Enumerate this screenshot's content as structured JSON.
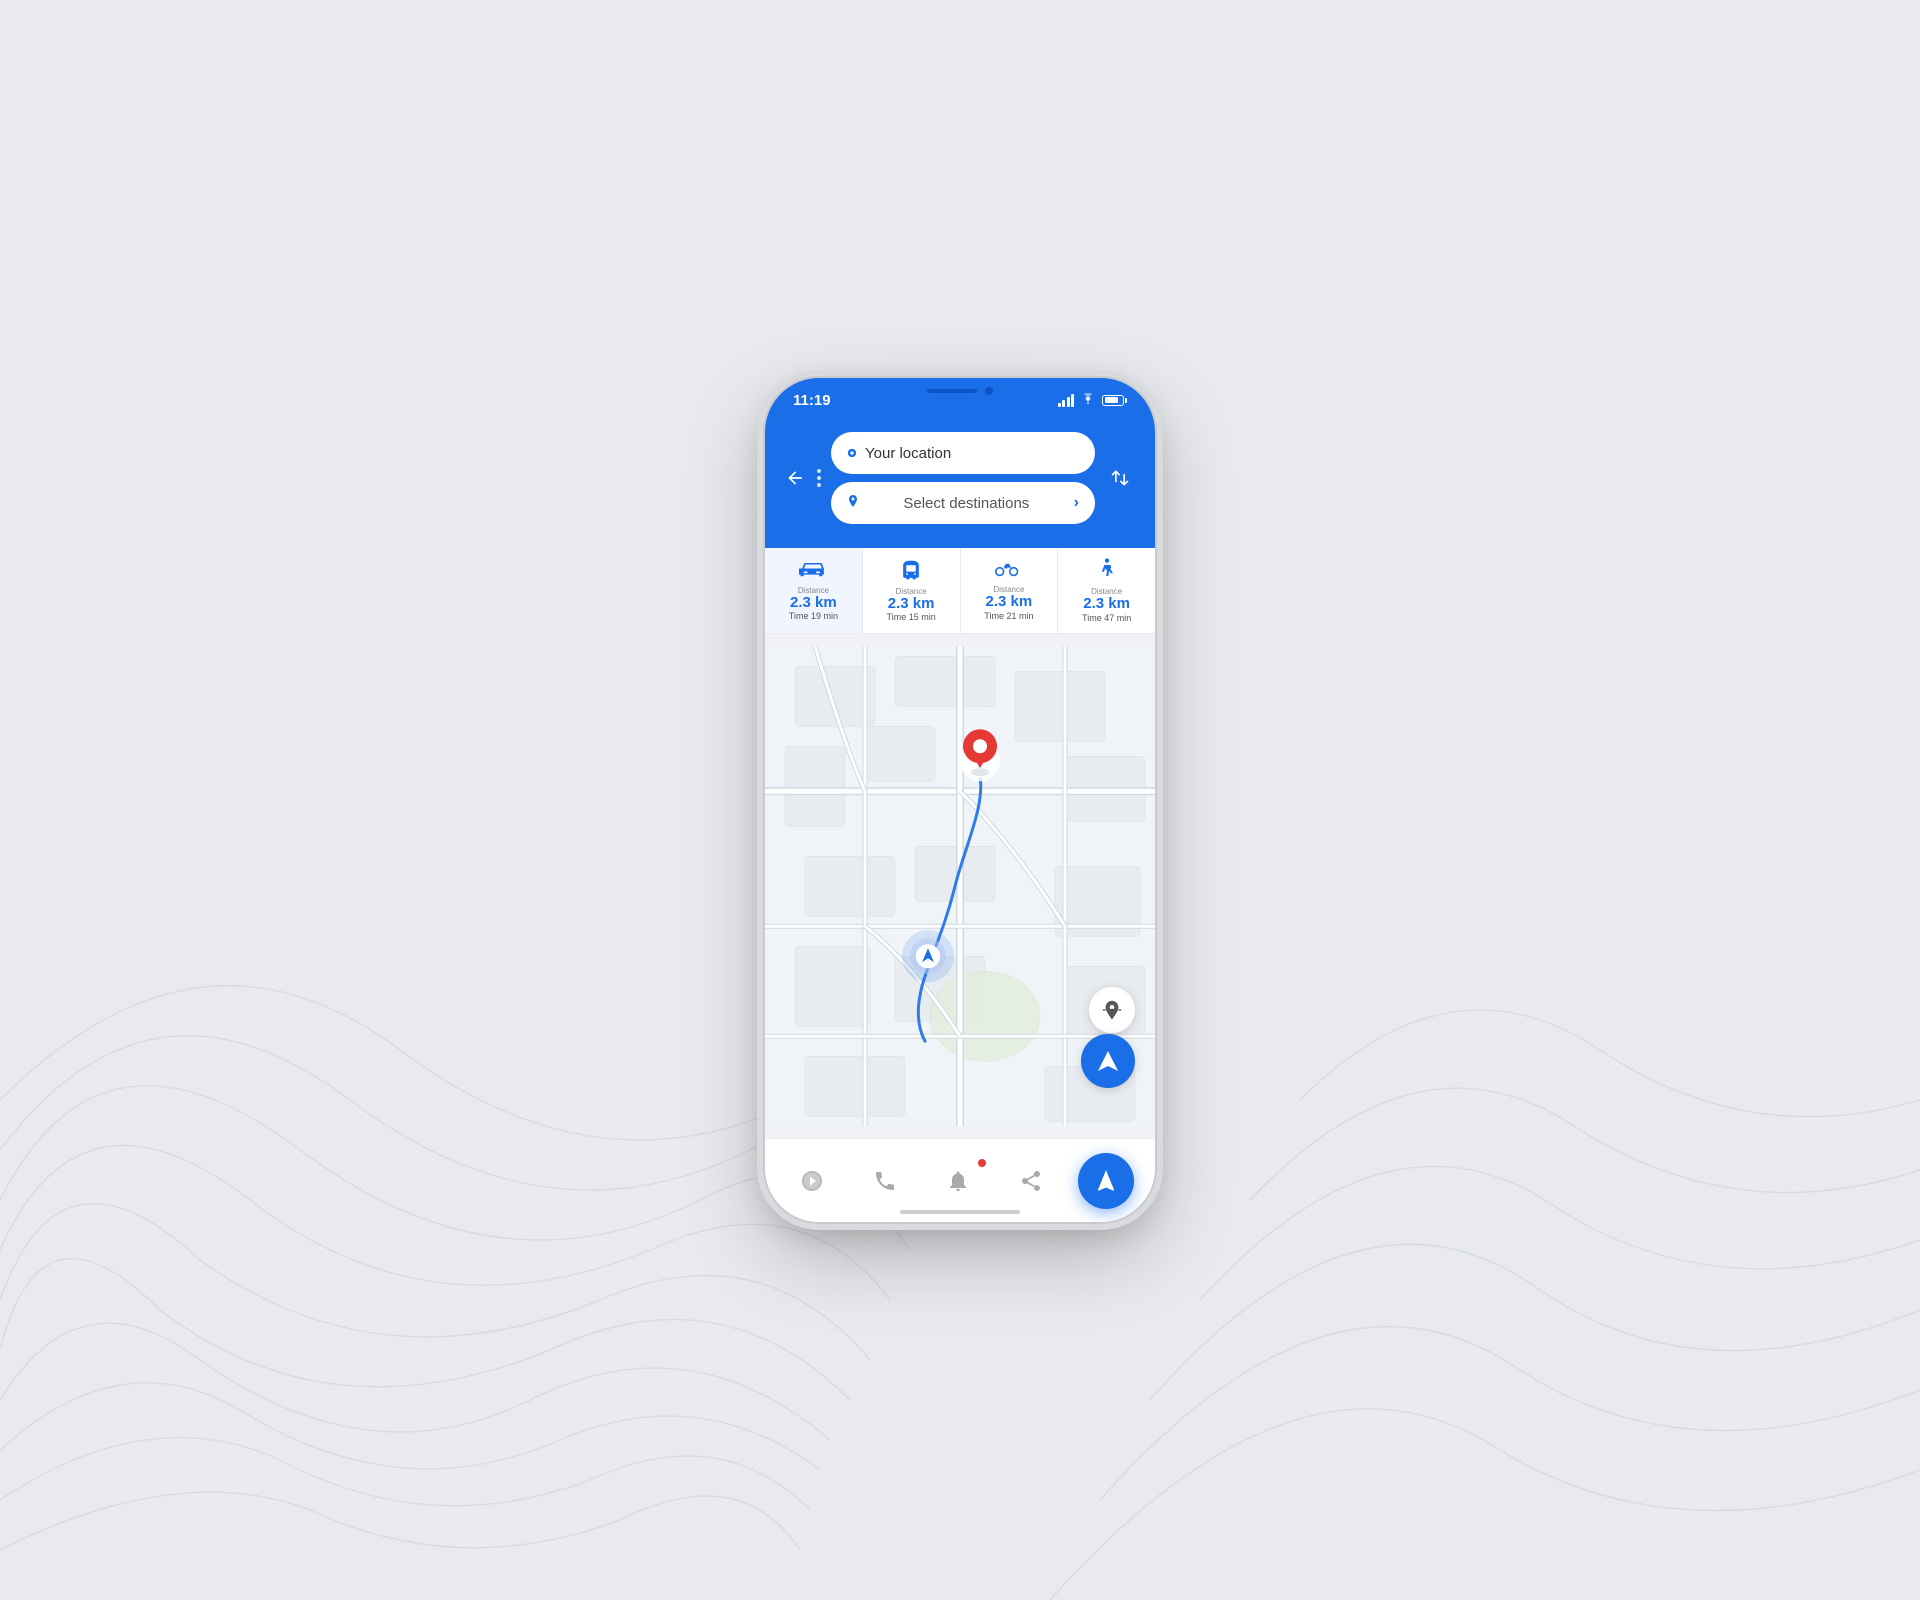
{
  "statusBar": {
    "time": "11:19",
    "signal": "●●●●",
    "wifi": "wifi",
    "battery": "battery"
  },
  "header": {
    "backLabel": "←",
    "swapLabel": "⇅",
    "locationInput": {
      "placeholder": "Your location",
      "value": "Your location"
    },
    "destinationInput": {
      "placeholder": "Select destinations",
      "value": "Select destinations",
      "chevron": "›"
    }
  },
  "transportModes": [
    {
      "id": "car",
      "icon": "🚗",
      "distanceLabel": "Distance",
      "distance": "2.3 km",
      "timeLabel": "Time",
      "time": "19 min",
      "active": true
    },
    {
      "id": "bus",
      "icon": "🚌",
      "distanceLabel": "Distance",
      "distance": "2.3 km",
      "timeLabel": "Time",
      "time": "15 min",
      "active": false
    },
    {
      "id": "bike",
      "icon": "🚲",
      "distanceLabel": "Distance",
      "distance": "2.3 km",
      "timeLabel": "Time",
      "time": "21 min",
      "active": false
    },
    {
      "id": "walk",
      "icon": "🚶",
      "distanceLabel": "Distance",
      "distance": "2.3 km",
      "timeLabel": "Time",
      "time": "47 min",
      "active": false
    }
  ],
  "bottomNav": {
    "items": [
      {
        "id": "explore",
        "icon": "◈",
        "label": ""
      },
      {
        "id": "call",
        "icon": "📞",
        "label": ""
      },
      {
        "id": "notifications",
        "icon": "🔔",
        "label": "",
        "hasNotification": true
      },
      {
        "id": "share",
        "icon": "⎋",
        "label": ""
      }
    ],
    "activeItem": {
      "id": "navigate",
      "icon": "➤"
    }
  },
  "map": {
    "locateButtonIcon": "⊕",
    "navigateButtonIcon": "➤"
  },
  "colors": {
    "blue": "#1a6fe8",
    "red": "#e53935",
    "lightBlue": "#b3c8f0"
  }
}
